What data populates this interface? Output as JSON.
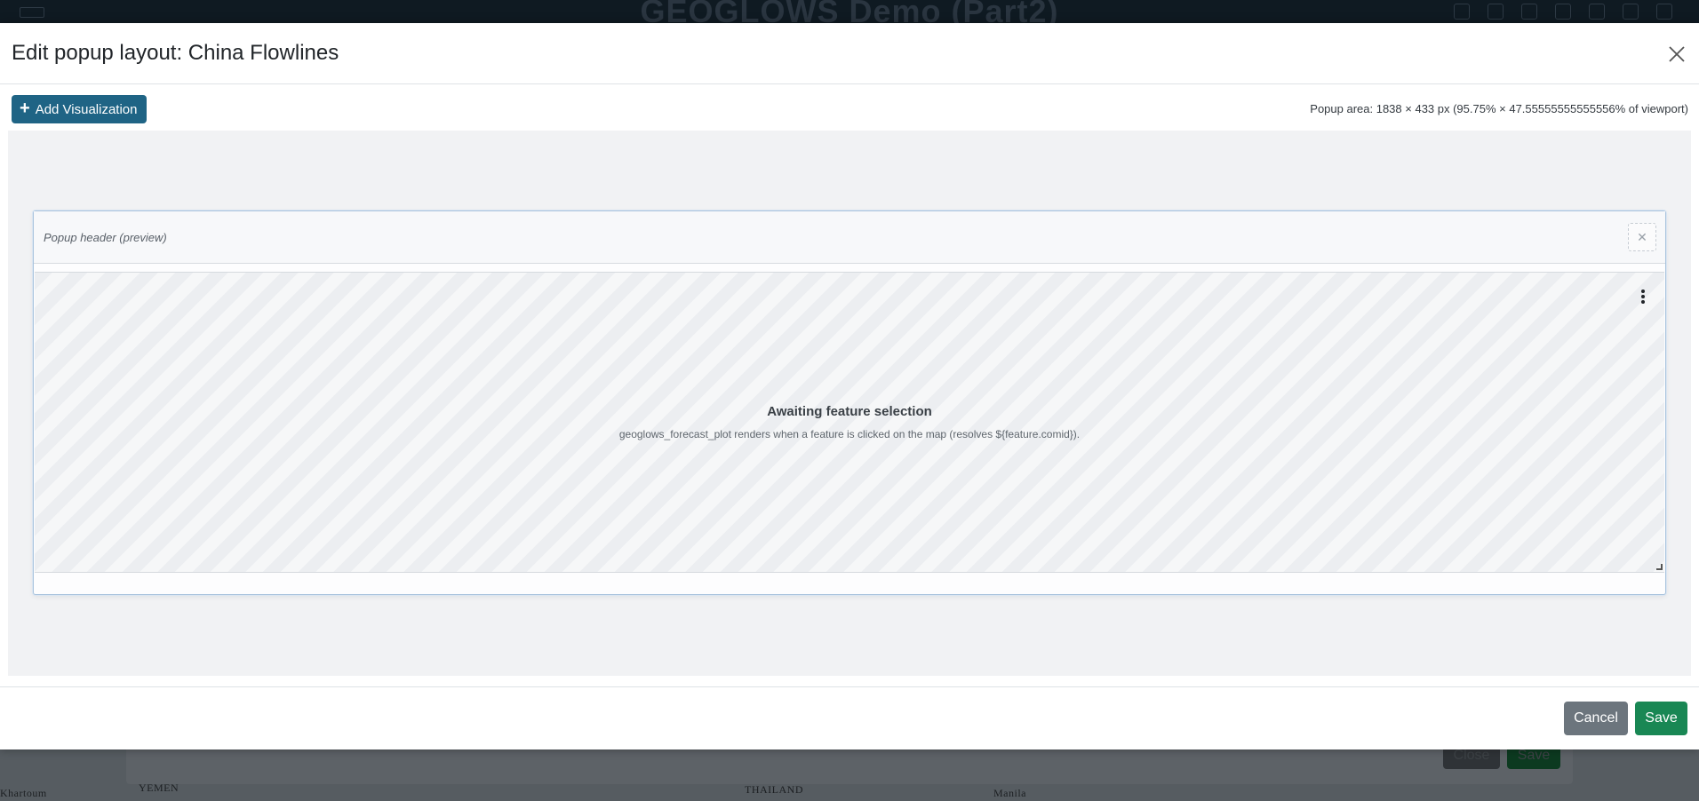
{
  "background": {
    "app_title": "GEOGLOWS Demo (Part2)",
    "dialog_close_label": "Close",
    "dialog_save_label": "Save",
    "map_labels": [
      "Khartoum",
      "YEMEN",
      "THAILAND",
      "Manila"
    ]
  },
  "modal": {
    "title": "Edit popup layout: China Flowlines",
    "add_visualization_label": "Add Visualization",
    "popup_area_info": "Popup area: 1838 × 433 px (95.75% × 47.55555555555556% of viewport)",
    "popup_header_preview": "Popup header (preview)",
    "visualization": {
      "status_title": "Awaiting feature selection",
      "status_detail": "geoglows_forecast_plot renders when a feature is clicked on the map (resolves ${feature.comid})."
    },
    "footer": {
      "cancel_label": "Cancel",
      "save_label": "Save"
    }
  },
  "colors": {
    "primary": "#1f6485",
    "success": "#198754",
    "secondary": "#6c757d"
  }
}
